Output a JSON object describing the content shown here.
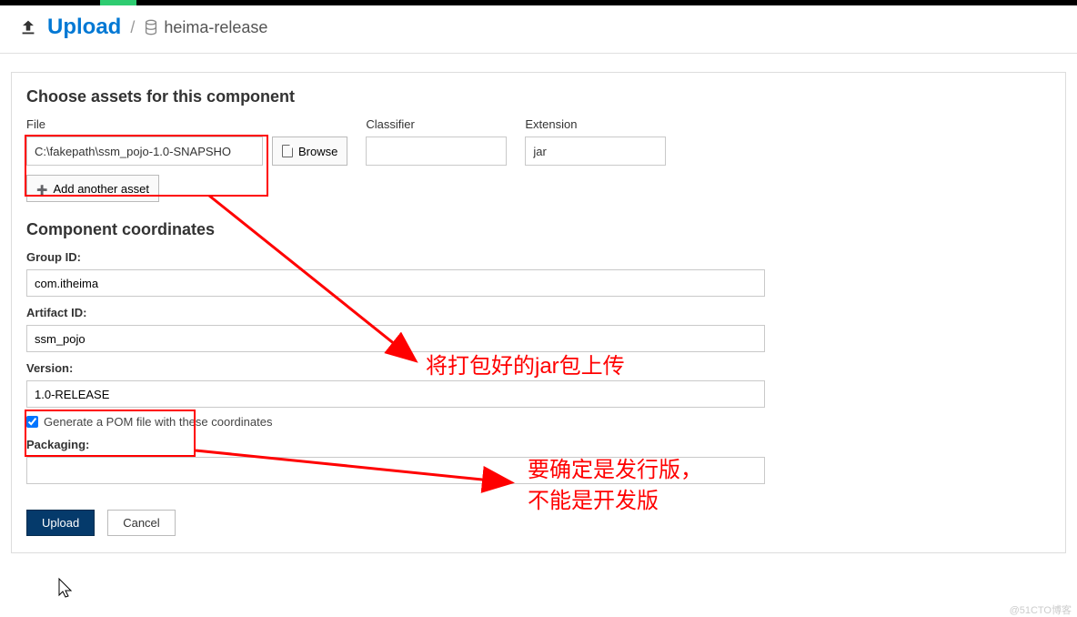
{
  "breadcrumb": {
    "title": "Upload",
    "repository": "heima-release"
  },
  "assets": {
    "heading": "Choose assets for this component",
    "file_label": "File",
    "file_value": "C:\\fakepath\\ssm_pojo-1.0-SNAPSHO",
    "browse_label": "Browse",
    "classifier_label": "Classifier",
    "classifier_value": "",
    "extension_label": "Extension",
    "extension_value": "jar",
    "add_another_label": "Add another asset"
  },
  "coordinates": {
    "heading": "Component coordinates",
    "group_id_label": "Group ID:",
    "group_id_value": "com.itheima",
    "artifact_id_label": "Artifact ID:",
    "artifact_id_value": "ssm_pojo",
    "version_label": "Version:",
    "version_value": "1.0-RELEASE",
    "generate_pom_label": "Generate a POM file with these coordinates",
    "generate_pom_checked": true,
    "packaging_label": "Packaging:",
    "packaging_value": ""
  },
  "buttons": {
    "upload": "Upload",
    "cancel": "Cancel"
  },
  "annotations": {
    "a1": "将打包好的jar包上传",
    "a2_line1": "要确定是发行版，",
    "a2_line2": "不能是开发版"
  },
  "watermark": "@51CTO博客"
}
